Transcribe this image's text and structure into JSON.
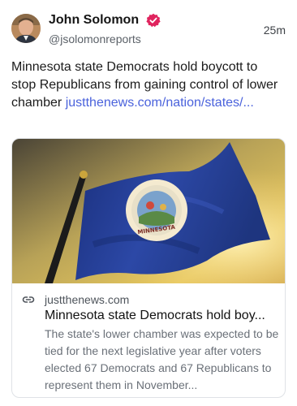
{
  "author": {
    "name": "John Solomon",
    "handle": "@jsolomonreports",
    "avatar_icon": "avatar",
    "verified_icon": "verified-badge-icon",
    "verified_color": "#e0245e"
  },
  "timestamp": "25m",
  "post": {
    "text": "Minnesota state Democrats hold boycott to stop Republicans from gaining control of lower chamber ",
    "link_text": "justthenews.com/nation/states/...",
    "link_color": "#4a62dc"
  },
  "link_card": {
    "image_icon": "minnesota-flag-image",
    "domain": "justthenews.com",
    "title": "Minnesota state Democrats hold boy...",
    "description": "The state's lower chamber was expected to be tied for the next legislative year after voters elected 67 Democrats and 67 Republicans to represent them in November...",
    "link_icon": "link-icon"
  }
}
